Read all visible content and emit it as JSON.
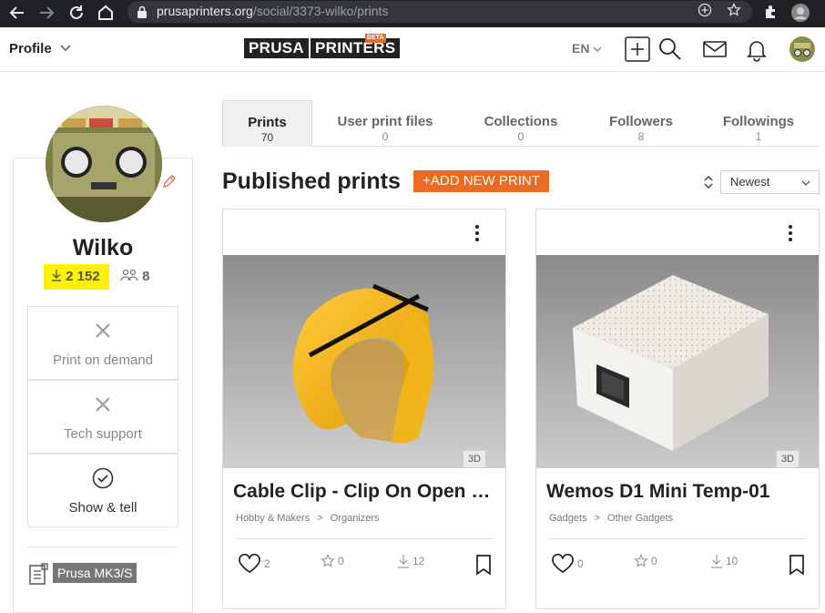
{
  "browser": {
    "url_domain": "prusaprinters.org",
    "url_path": "/social/3373-wilko/prints"
  },
  "header": {
    "profile_label": "Profile",
    "logo_left": "PRUSA",
    "logo_right": "PRINTERS",
    "logo_badge": "BETA",
    "language": "EN"
  },
  "profile": {
    "username": "Wilko",
    "downloads": "2 152",
    "followers": "8",
    "services": [
      {
        "label": "Print on demand",
        "icon": "close-icon",
        "enabled": false
      },
      {
        "label": "Tech support",
        "icon": "close-icon",
        "enabled": false
      },
      {
        "label": "Show & tell",
        "icon": "check-circle-icon",
        "enabled": true
      }
    ],
    "printer": "Prusa MK3/S"
  },
  "tabs": [
    {
      "label": "Prints",
      "count": "70",
      "active": true
    },
    {
      "label": "User print files",
      "count": "0",
      "active": false
    },
    {
      "label": "Collections",
      "count": "0",
      "active": false
    },
    {
      "label": "Followers",
      "count": "8",
      "active": false
    },
    {
      "label": "Followings",
      "count": "1",
      "active": false
    }
  ],
  "main": {
    "section_title": "Published prints",
    "add_button": "+ADD NEW PRINT",
    "sort_value": "Newest"
  },
  "prints": [
    {
      "title": "Cable Clip - Clip On Open Reel",
      "category": "Hobby & Makers",
      "subcategory": "Organizers",
      "separator": ">",
      "badge": "3D",
      "likes": "2",
      "stars": "0",
      "downloads": "12"
    },
    {
      "title": "Wemos D1 Mini Temp-01",
      "category": "Gadgets",
      "subcategory": "Other Gadgets",
      "separator": ">",
      "badge": "3D",
      "likes": "0",
      "stars": "0",
      "downloads": "10"
    }
  ],
  "colors": {
    "accent": "#ed6b21",
    "highlight": "#fff200",
    "chrome_bg": "#202124"
  }
}
